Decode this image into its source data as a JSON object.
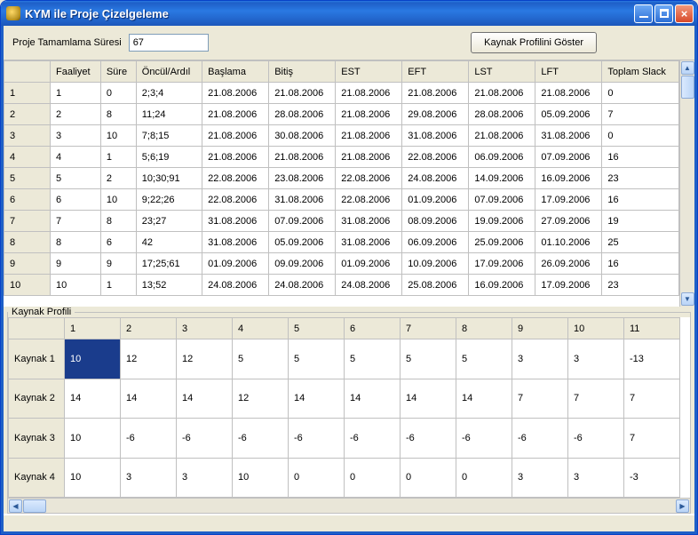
{
  "window": {
    "title": "KYM ile Proje Çizelgeleme"
  },
  "toolbar": {
    "duration_label": "Proje Tamamlama Süresi",
    "duration_value": "67",
    "profile_button": "Kaynak Profilini Göster"
  },
  "main_grid": {
    "columns": [
      "Faaliyet",
      "Süre",
      "Öncül/Ardıl",
      "Başlama",
      "Bitiş",
      "EST",
      "EFT",
      "LST",
      "LFT",
      "Toplam Slack"
    ],
    "rows": [
      {
        "idx": "1",
        "cells": [
          "1",
          "0",
          "2;3;4",
          "21.08.2006",
          "21.08.2006",
          "21.08.2006",
          "21.08.2006",
          "21.08.2006",
          "21.08.2006",
          "0"
        ]
      },
      {
        "idx": "2",
        "cells": [
          "2",
          "8",
          "11;24",
          "21.08.2006",
          "28.08.2006",
          "21.08.2006",
          "29.08.2006",
          "28.08.2006",
          "05.09.2006",
          "7"
        ]
      },
      {
        "idx": "3",
        "cells": [
          "3",
          "10",
          "7;8;15",
          "21.08.2006",
          "30.08.2006",
          "21.08.2006",
          "31.08.2006",
          "21.08.2006",
          "31.08.2006",
          "0"
        ]
      },
      {
        "idx": "4",
        "cells": [
          "4",
          "1",
          "5;6;19",
          "21.08.2006",
          "21.08.2006",
          "21.08.2006",
          "22.08.2006",
          "06.09.2006",
          "07.09.2006",
          "16"
        ]
      },
      {
        "idx": "5",
        "cells": [
          "5",
          "2",
          "10;30;91",
          "22.08.2006",
          "23.08.2006",
          "22.08.2006",
          "24.08.2006",
          "14.09.2006",
          "16.09.2006",
          "23"
        ]
      },
      {
        "idx": "6",
        "cells": [
          "6",
          "10",
          "9;22;26",
          "22.08.2006",
          "31.08.2006",
          "22.08.2006",
          "01.09.2006",
          "07.09.2006",
          "17.09.2006",
          "16"
        ]
      },
      {
        "idx": "7",
        "cells": [
          "7",
          "8",
          "23;27",
          "31.08.2006",
          "07.09.2006",
          "31.08.2006",
          "08.09.2006",
          "19.09.2006",
          "27.09.2006",
          "19"
        ]
      },
      {
        "idx": "8",
        "cells": [
          "8",
          "6",
          "42",
          "31.08.2006",
          "05.09.2006",
          "31.08.2006",
          "06.09.2006",
          "25.09.2006",
          "01.10.2006",
          "25"
        ]
      },
      {
        "idx": "9",
        "cells": [
          "9",
          "9",
          "17;25;61",
          "01.09.2006",
          "09.09.2006",
          "01.09.2006",
          "10.09.2006",
          "17.09.2006",
          "26.09.2006",
          "16"
        ]
      },
      {
        "idx": "10",
        "cells": [
          "10",
          "1",
          "13;52",
          "24.08.2006",
          "24.08.2006",
          "24.08.2006",
          "25.08.2006",
          "16.09.2006",
          "17.09.2006",
          "23"
        ]
      }
    ]
  },
  "profile": {
    "legend": "Kaynak Profili",
    "columns": [
      "1",
      "2",
      "3",
      "4",
      "5",
      "6",
      "7",
      "8",
      "9",
      "10",
      "11"
    ],
    "rows": [
      {
        "label": "Kaynak 1",
        "cells": [
          "10",
          "12",
          "12",
          "5",
          "5",
          "5",
          "5",
          "5",
          "3",
          "3",
          "-13"
        ],
        "selected": 0
      },
      {
        "label": "Kaynak 2",
        "cells": [
          "14",
          "14",
          "14",
          "12",
          "14",
          "14",
          "14",
          "14",
          "7",
          "7",
          "7"
        ]
      },
      {
        "label": "Kaynak 3",
        "cells": [
          "10",
          "-6",
          "-6",
          "-6",
          "-6",
          "-6",
          "-6",
          "-6",
          "-6",
          "-6",
          "7"
        ]
      },
      {
        "label": "Kaynak 4",
        "cells": [
          "10",
          "3",
          "3",
          "10",
          "0",
          "0",
          "0",
          "0",
          "3",
          "3",
          "-3"
        ]
      }
    ]
  }
}
